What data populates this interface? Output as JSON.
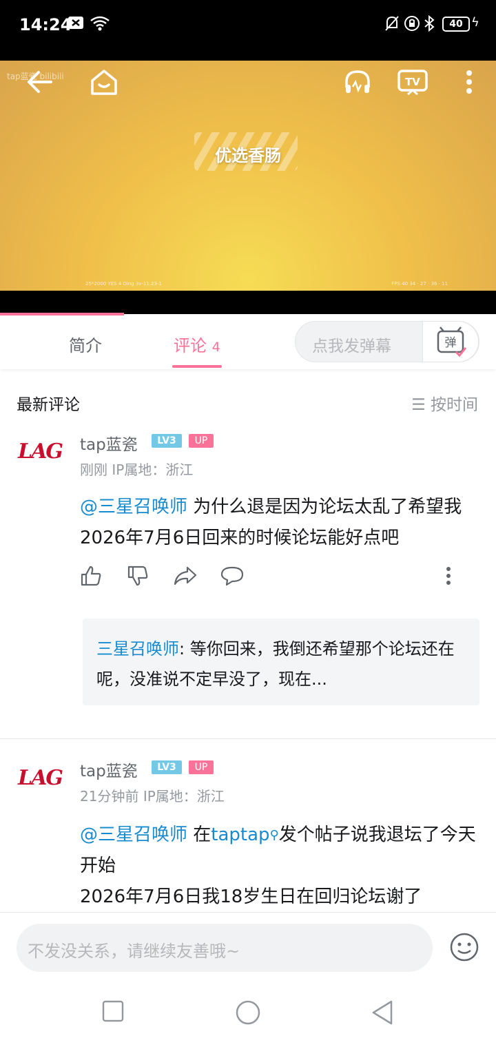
{
  "status_bar": {
    "time": "14:24",
    "battery": "40"
  },
  "video": {
    "watermark": "tap蓝瓷 bilibili",
    "center_text": "优选香肠",
    "fps_text": "FPS 40 34 · 27 · 36 · 11",
    "version_text": "25*2000 YES 4 Ding 3v-11.23-1",
    "progress_fraction": 0.25
  },
  "tabs": [
    {
      "label": "简介",
      "active": false
    },
    {
      "label": "评论",
      "count": "4",
      "active": true
    }
  ],
  "danmaku": {
    "placeholder": "点我发弹幕",
    "button_label": "弹"
  },
  "comments_header": {
    "title": "最新评论",
    "sort_label": "按时间"
  },
  "comments": [
    {
      "user": "tap蓝瓷",
      "avatar_text": "LAG",
      "level": "LV3",
      "badge": "UP",
      "time": "刚刚",
      "ip": "IP属地：浙江",
      "mention": "@三星召唤师",
      "text": " 为什么退是因为论坛太乱了希望我2026年7月6日回来的时候论坛能好点吧",
      "reply": {
        "user": "三星召唤师",
        "text": ": 等你回来，我倒还希望那个论坛还在呢，没准说不定早没了，现在..."
      }
    },
    {
      "user": "tap蓝瓷",
      "avatar_text": "LAG",
      "level": "LV3",
      "badge": "UP",
      "time": "21分钟前",
      "ip": "IP属地：浙江",
      "mention": "@三星召唤师",
      "text_before_link": " 在",
      "link": "taptap",
      "text_after_link": "发个帖子说我退坛了今天开始",
      "text_line3": "2026年7月6日我18岁生日在回归论坛谢了"
    }
  ],
  "comment_input": {
    "placeholder": "不发没关系，请继续友善哦~"
  },
  "colors": {
    "accent": "#fb7299",
    "link": "#178bcf",
    "level": "#73c9e5"
  }
}
